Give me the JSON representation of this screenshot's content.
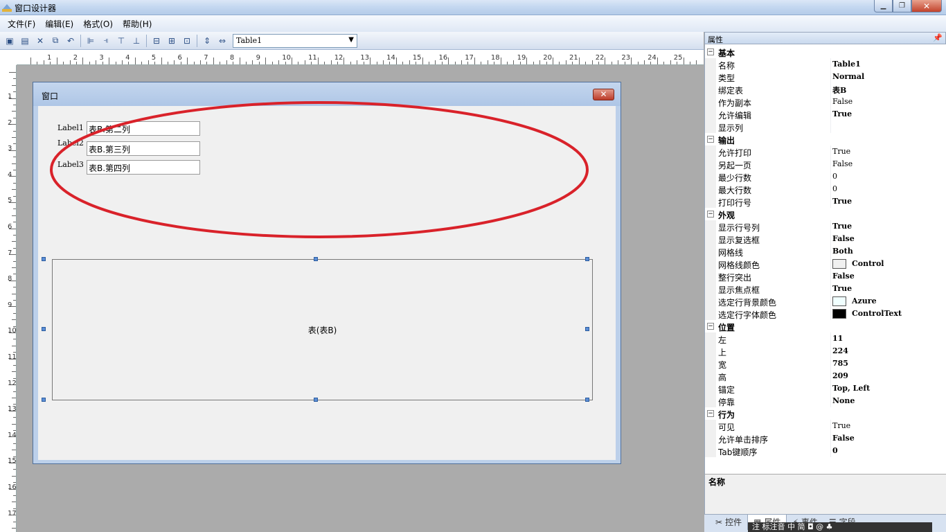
{
  "window": {
    "title": "窗口设计器",
    "buttons": {
      "minimize": "▁",
      "maximize": "❐",
      "close": "✕"
    }
  },
  "menu": [
    "文件(F)",
    "编辑(E)",
    "格式(O)",
    "帮助(H)"
  ],
  "toolbar": {
    "icons": [
      "save-icon",
      "save-all-icon",
      "delete-icon",
      "copy-icon",
      "undo-icon",
      "align-left-icon",
      "align-right-icon",
      "align-top-icon",
      "align-bottom-icon",
      "same-width-icon",
      "same-height-icon",
      "same-size-icon",
      "vertical-spacing-icon",
      "horizontal-spacing-icon"
    ],
    "object_select": "Table1"
  },
  "ruler": {
    "h_numbers": [
      "1",
      "2",
      "3",
      "4",
      "5",
      "6",
      "7",
      "8",
      "9",
      "10",
      "11",
      "12",
      "13",
      "14",
      "15",
      "16",
      "17",
      "18",
      "19",
      "20",
      "21",
      "22",
      "23",
      "24",
      "25"
    ],
    "v_numbers": [
      "1",
      "2",
      "3",
      "4",
      "5",
      "6",
      "7",
      "8",
      "9",
      "10",
      "11",
      "12",
      "13",
      "14",
      "15",
      "16",
      "17"
    ]
  },
  "designed_window": {
    "title": "窗口",
    "close": "✕",
    "labels": [
      "Label1",
      "Label2",
      "Label3"
    ],
    "textboxes": [
      "表B.第二列",
      "表B.第三列",
      "表B.第四列"
    ],
    "table_caption": "表(表B)"
  },
  "properties": {
    "header": "属性",
    "pin": "ᵖ",
    "categories": [
      {
        "name": "基本",
        "rows": [
          {
            "name": "名称",
            "value": "Table1",
            "bold": true
          },
          {
            "name": "类型",
            "value": "Normal",
            "bold": true
          },
          {
            "name": "绑定表",
            "value": "表B",
            "bold": true
          },
          {
            "name": "作为副本",
            "value": "False",
            "bold": false
          },
          {
            "name": "允许编辑",
            "value": "True",
            "bold": true
          },
          {
            "name": "显示列",
            "value": "",
            "bold": false
          }
        ]
      },
      {
        "name": "输出",
        "rows": [
          {
            "name": "允许打印",
            "value": "True",
            "bold": false
          },
          {
            "name": "另起一页",
            "value": "False",
            "bold": false
          },
          {
            "name": "最少行数",
            "value": "0",
            "bold": false
          },
          {
            "name": "最大行数",
            "value": "0",
            "bold": false
          },
          {
            "name": "打印行号",
            "value": "True",
            "bold": true
          }
        ]
      },
      {
        "name": "外观",
        "rows": [
          {
            "name": "显示行号列",
            "value": "True",
            "bold": true
          },
          {
            "name": "显示复选框",
            "value": "False",
            "bold": true
          },
          {
            "name": "网格线",
            "value": "Both",
            "bold": true
          },
          {
            "name": "网格线颜色",
            "value": "Control",
            "bold": true,
            "swatch": "#f0f0f0"
          },
          {
            "name": "整行突出",
            "value": "False",
            "bold": true
          },
          {
            "name": "显示焦点框",
            "value": "True",
            "bold": true
          },
          {
            "name": "选定行背景颜色",
            "value": "Azure",
            "bold": true,
            "swatch": "#f0ffff"
          },
          {
            "name": "选定行字体颜色",
            "value": "ControlText",
            "bold": true,
            "swatch": "#000000"
          }
        ]
      },
      {
        "name": "位置",
        "rows": [
          {
            "name": "左",
            "value": "11",
            "bold": true
          },
          {
            "name": "上",
            "value": "224",
            "bold": true
          },
          {
            "name": "宽",
            "value": "785",
            "bold": true
          },
          {
            "name": "高",
            "value": "209",
            "bold": true
          },
          {
            "name": "锚定",
            "value": "Top, Left",
            "bold": true
          },
          {
            "name": "停靠",
            "value": "None",
            "bold": true
          }
        ]
      },
      {
        "name": "行为",
        "rows": [
          {
            "name": "可见",
            "value": "True",
            "bold": false
          },
          {
            "name": "允许单击排序",
            "value": "False",
            "bold": true
          },
          {
            "name": "Tab键顺序",
            "value": "0",
            "bold": true
          }
        ]
      }
    ],
    "description_title": "名称",
    "tabs": [
      "控件",
      "属性",
      "事件",
      "字段"
    ],
    "active_tab": "属性"
  },
  "ime_bar": "注 标注音 中 简 ◘ @ ♣",
  "colors": {
    "accent": "#4f6f9a",
    "highlight_ellipse": "#d9222a",
    "handle": "#5b8ed6"
  }
}
